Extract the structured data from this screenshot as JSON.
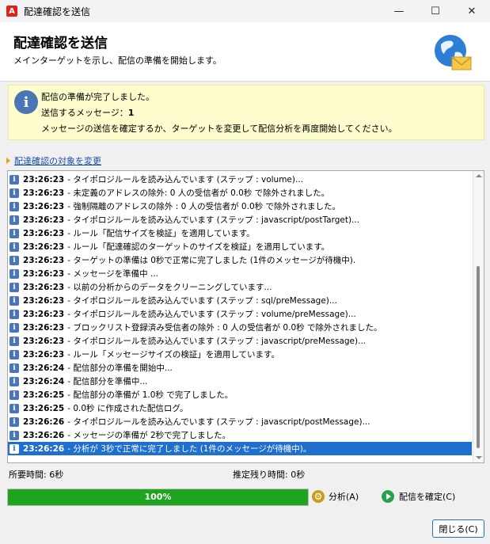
{
  "window": {
    "title": "配達確認を送信",
    "logo": "A",
    "minimize_glyph": "—",
    "maximize_glyph": "☐",
    "close_glyph": "✕"
  },
  "header": {
    "title": "配達確認を送信",
    "subtitle": "メインターゲットを示し、配信の準備を開始します。",
    "icon": "globe-mail-icon"
  },
  "info": {
    "icon": "info-icon",
    "line1": "配信の準備が完了しました。",
    "messages_label": "送信するメッセージ：",
    "messages_count": "1",
    "line3": "メッセージの送信を確定するか、ターゲットを変更して配信分析を再度開始してください。"
  },
  "change_link": {
    "label": "配達確認の対象を変更"
  },
  "log": {
    "rows": [
      {
        "time": "23:26:23",
        "text": "- タイポロジルールを読み込んでいます (ステップ : volume)..."
      },
      {
        "time": "23:26:23",
        "text": "- 未定義のアドレスの除外: 0 人の受信者が 0.0秒 で除外されました。"
      },
      {
        "time": "23:26:23",
        "text": "- 強制隔離のアドレスの除外 : 0 人の受信者が 0.0秒 で除外されました。"
      },
      {
        "time": "23:26:23",
        "text": "- タイポロジルールを読み込んでいます (ステップ : javascript/postTarget)..."
      },
      {
        "time": "23:26:23",
        "text": "- ルール「配信サイズを検証」を適用しています。"
      },
      {
        "time": "23:26:23",
        "text": "- ルール「配達確認のターゲットのサイズを検証」を適用しています。"
      },
      {
        "time": "23:26:23",
        "text": "- ターゲットの準備は 0秒で正常に完了しました (1件のメッセージが待機中)."
      },
      {
        "time": "23:26:23",
        "text": "- メッセージを準備中 ..."
      },
      {
        "time": "23:26:23",
        "text": "- 以前の分析からのデータをクリーニングしています..."
      },
      {
        "time": "23:26:23",
        "text": "- タイポロジルールを読み込んでいます (ステップ : sql/preMessage)..."
      },
      {
        "time": "23:26:23",
        "text": "- タイポロジルールを読み込んでいます (ステップ : volume/preMessage)..."
      },
      {
        "time": "23:26:23",
        "text": "- ブロックリスト登録済み受信者の除外 : 0 人の受信者が 0.0秒 で除外されました。"
      },
      {
        "time": "23:26:23",
        "text": "- タイポロジルールを読み込んでいます (ステップ : javascript/preMessage)..."
      },
      {
        "time": "23:26:23",
        "text": "- ルール「メッセージサイズの検証」を適用しています。"
      },
      {
        "time": "23:26:24",
        "text": "- 配信部分の準備を開始中..."
      },
      {
        "time": "23:26:24",
        "text": "- 配信部分を準備中..."
      },
      {
        "time": "23:26:25",
        "text": "- 配信部分の準備が 1.0秒 で完了しました。"
      },
      {
        "time": "23:26:25",
        "text": "- 0.0秒 に作成された配信ログ。"
      },
      {
        "time": "23:26:26",
        "text": "- タイポロジルールを読み込んでいます (ステップ : javascript/postMessage)..."
      },
      {
        "time": "23:26:26",
        "text": "- メッセージの準備が 2秒で完了しました。"
      },
      {
        "time": "23:26:26",
        "text": "- 分析が 3秒で正常に完了しました (1件のメッセージが待機中)。",
        "selected": true
      }
    ]
  },
  "status": {
    "elapsed": "所要時間: 6秒",
    "remaining": "推定残り時間:  0秒"
  },
  "progress": {
    "percent": 100,
    "label": "100%",
    "color": "#1fa41f"
  },
  "actions": {
    "analyze_label": "分析(A)",
    "confirm_label": "配信を確定(C)"
  },
  "footer": {
    "close_label": "閉じる(C)"
  }
}
